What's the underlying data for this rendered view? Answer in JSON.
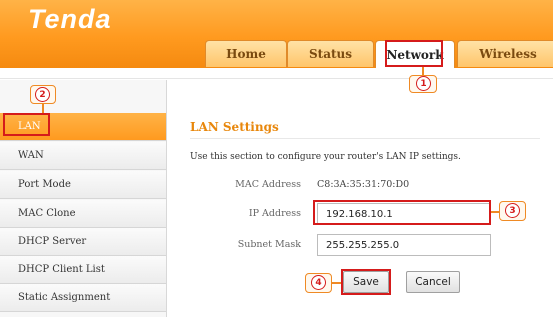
{
  "brand": {
    "logo_text": "Tenda"
  },
  "tabs": [
    {
      "label": "Home"
    },
    {
      "label": "Status"
    },
    {
      "label": "Network"
    },
    {
      "label": "Wireless"
    }
  ],
  "sidebar": {
    "items": [
      {
        "label": "LAN"
      },
      {
        "label": "WAN"
      },
      {
        "label": "Port Mode"
      },
      {
        "label": "MAC Clone"
      },
      {
        "label": "DHCP Server"
      },
      {
        "label": "DHCP Client List"
      },
      {
        "label": "Static Assignment"
      }
    ]
  },
  "lan_settings": {
    "title": "LAN Settings",
    "description": "Use this section to configure your router's LAN IP settings.",
    "mac_label": "MAC Address",
    "mac_value": "C8:3A:35:31:70:D0",
    "ip_label": "IP Address",
    "ip_value": "192.168.10.1",
    "mask_label": "Subnet Mask",
    "mask_value": "255.255.255.0",
    "save_label": "Save",
    "cancel_label": "Cancel"
  },
  "annotations": {
    "step1": "1",
    "step2": "2",
    "step3": "3",
    "step4": "4"
  },
  "colors": {
    "accent": "#ff9a1f",
    "highlight": "#d51b1b",
    "title": "#e8870c"
  }
}
